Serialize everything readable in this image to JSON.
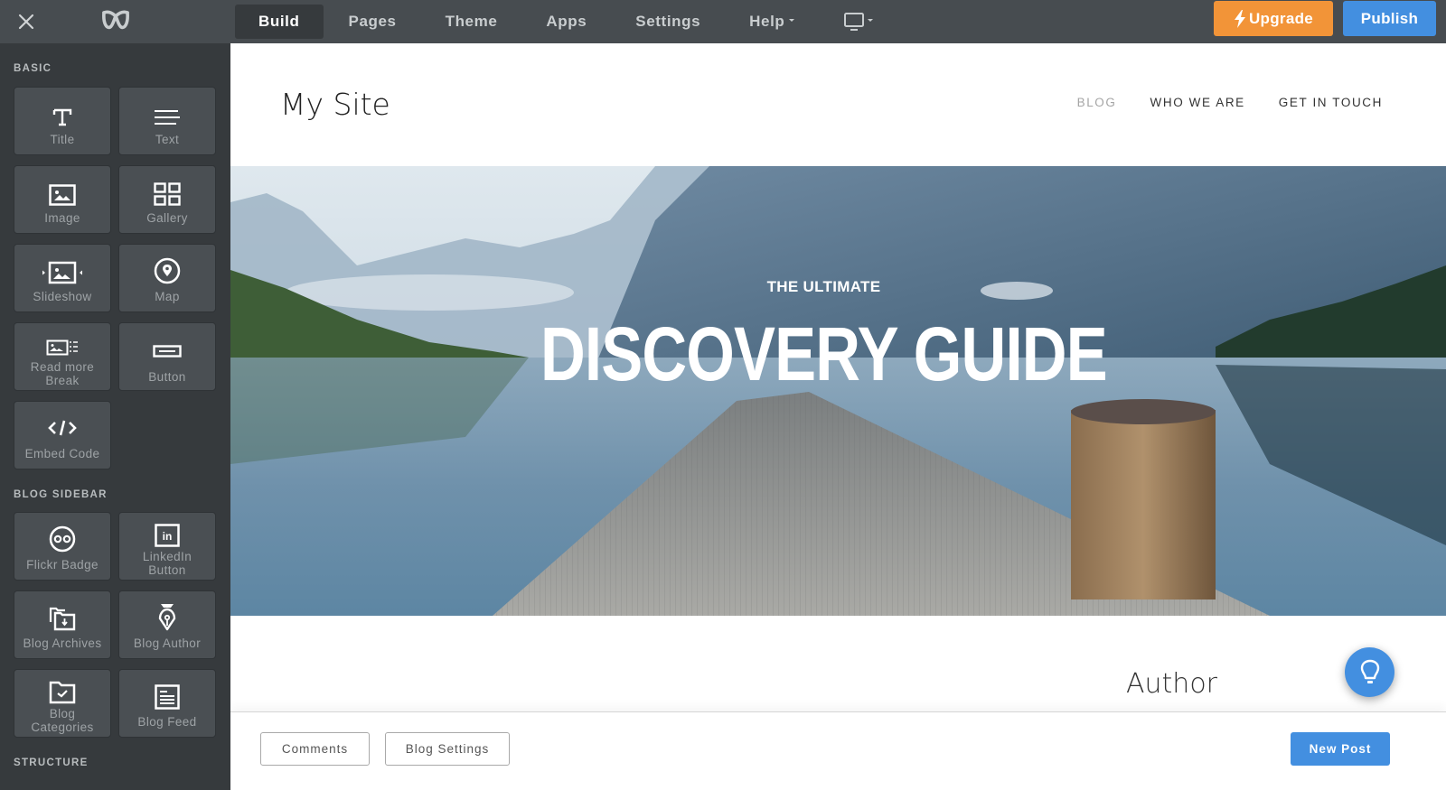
{
  "topbar": {
    "close_icon": "close-icon",
    "logo_icon": "weebly-logo-icon",
    "tabs": [
      {
        "label": "Build",
        "active": true
      },
      {
        "label": "Pages",
        "active": false
      },
      {
        "label": "Theme",
        "active": false
      },
      {
        "label": "Apps",
        "active": false
      },
      {
        "label": "Settings",
        "active": false
      },
      {
        "label": "Help",
        "active": false,
        "has_dropdown": true
      }
    ],
    "device_icon": "desktop-monitor-icon",
    "upgrade_label": "Upgrade",
    "upgrade_icon": "lightning-bolt-icon",
    "publish_label": "Publish",
    "colors": {
      "upgrade": "#f29438",
      "publish": "#438fe0",
      "bar": "#474c50"
    }
  },
  "sidebar": {
    "sections": [
      {
        "label": "BASIC",
        "items": [
          {
            "label": "Title",
            "icon": "title-T-icon"
          },
          {
            "label": "Text",
            "icon": "text-lines-icon"
          },
          {
            "label": "Image",
            "icon": "image-icon"
          },
          {
            "label": "Gallery",
            "icon": "gallery-grid-icon"
          },
          {
            "label": "Slideshow",
            "icon": "slideshow-icon"
          },
          {
            "label": "Map",
            "icon": "map-pin-icon"
          },
          {
            "label": "Read more Break",
            "icon": "read-more-icon"
          },
          {
            "label": "Button",
            "icon": "button-icon"
          },
          {
            "label": "Embed Code",
            "icon": "code-icon"
          }
        ]
      },
      {
        "label": "BLOG SIDEBAR",
        "items": [
          {
            "label": "Flickr Badge",
            "icon": "flickr-icon"
          },
          {
            "label": "LinkedIn Button",
            "icon": "linkedin-icon"
          },
          {
            "label": "Blog Archives",
            "icon": "archive-folders-icon"
          },
          {
            "label": "Blog Author",
            "icon": "pen-nib-icon"
          },
          {
            "label": "Blog Categories",
            "icon": "folder-check-icon"
          },
          {
            "label": "Blog Feed",
            "icon": "feed-document-icon"
          }
        ]
      },
      {
        "label": "STRUCTURE",
        "items": []
      }
    ]
  },
  "site": {
    "title": "My Site",
    "nav": [
      {
        "label": "BLOG",
        "active": true
      },
      {
        "label": "WHO WE ARE",
        "active": false
      },
      {
        "label": "GET IN TOUCH",
        "active": false
      }
    ],
    "hero": {
      "kicker": "THE ULTIMATE",
      "title": "DISCOVERY GUIDE"
    },
    "author_heading": "Author"
  },
  "bottom_bar": {
    "comments_label": "Comments",
    "blog_settings_label": "Blog Settings",
    "new_post_label": "New Post"
  },
  "help_fab": {
    "icon": "lightbulb-icon"
  }
}
